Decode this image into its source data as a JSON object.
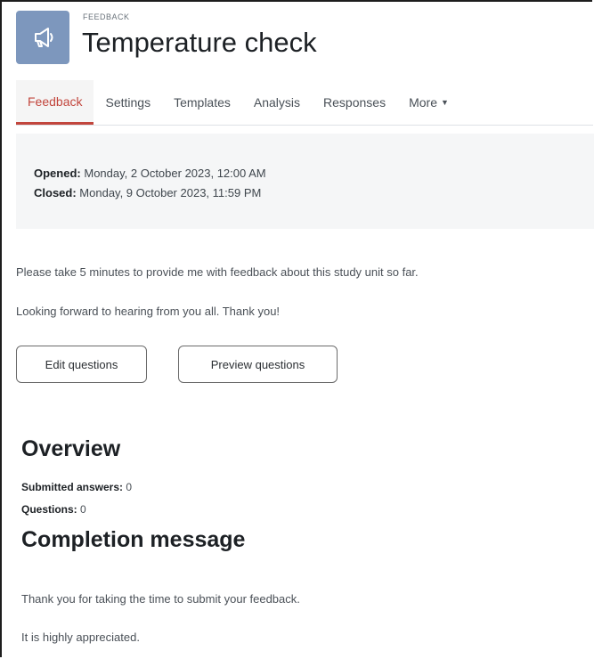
{
  "header": {
    "eyebrow": "FEEDBACK",
    "title": "Temperature check",
    "icon": "megaphone-icon",
    "icon_bg": "#7d97bd"
  },
  "tabs": [
    {
      "label": "Feedback",
      "active": true
    },
    {
      "label": "Settings"
    },
    {
      "label": "Templates"
    },
    {
      "label": "Analysis"
    },
    {
      "label": "Responses"
    },
    {
      "label": "More"
    }
  ],
  "dates": {
    "opened_label": "Opened:",
    "opened_value": "Monday, 2 October 2023, 12:00 AM",
    "closed_label": "Closed:",
    "closed_value": "Monday, 9 October 2023, 11:59 PM"
  },
  "intro": {
    "line1": "Please take 5 minutes to provide me with feedback about this study unit so far.",
    "line2": "Looking forward to hearing from you all. Thank you!"
  },
  "buttons": {
    "edit": "Edit questions",
    "preview": "Preview questions"
  },
  "overview": {
    "heading": "Overview",
    "submitted_label": "Submitted answers:",
    "submitted_value": "0",
    "questions_label": "Questions:",
    "questions_value": "0"
  },
  "completion": {
    "heading": "Completion message",
    "line1": "Thank you for taking the time to submit your feedback.",
    "line2": "It is highly appreciated."
  },
  "colors": {
    "accent": "#c2463d"
  }
}
